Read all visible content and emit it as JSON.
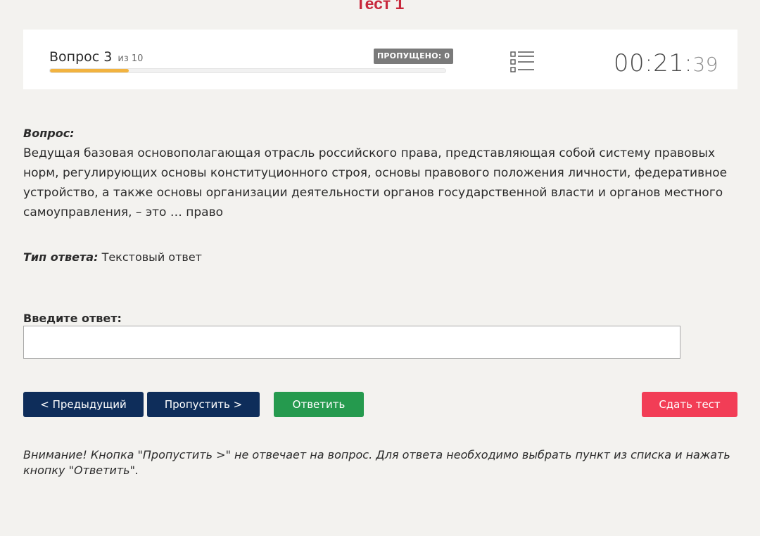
{
  "page": {
    "title": "Тест 1"
  },
  "status": {
    "question_label": "Вопрос 3",
    "question_of": "из 10",
    "progress_fraction": 0.2,
    "skipped_badge": "ПРОПУЩЕНО: 0",
    "list_icon": "question-list-icon",
    "timer_main": "00:21:",
    "timer_seconds": "39"
  },
  "question": {
    "label": "Вопрос:",
    "text": "Ведущая базовая основополагающая отрасль российского права, представляющая собой систему правовых норм, регулирующих основы конституционного строя, основы правового положения личности, федеративное устройство, а также основы организации деятельности органов государственной власти и органов местного самоуправления, – это … право"
  },
  "answer_type": {
    "label": "Тип ответа:",
    "value": "Текстовый ответ"
  },
  "answer_input": {
    "label": "Введите ответ:",
    "value": "",
    "placeholder": ""
  },
  "buttons": {
    "prev": "< Предыдущий",
    "skip": "Пропустить >",
    "answer": "Ответить",
    "finish": "Сдать тест"
  },
  "colors": {
    "accent_red": "#c8283c",
    "navy": "#0e2d5a",
    "green": "#259a4e",
    "pink": "#f23d56",
    "progress": "#f2b340"
  },
  "warning": "Внимание! Кнопка \"Пропустить >\" не отвечает на вопрос. Для ответа необходимо выбрать пункт из списка и нажать кнопку \"Ответить\"."
}
